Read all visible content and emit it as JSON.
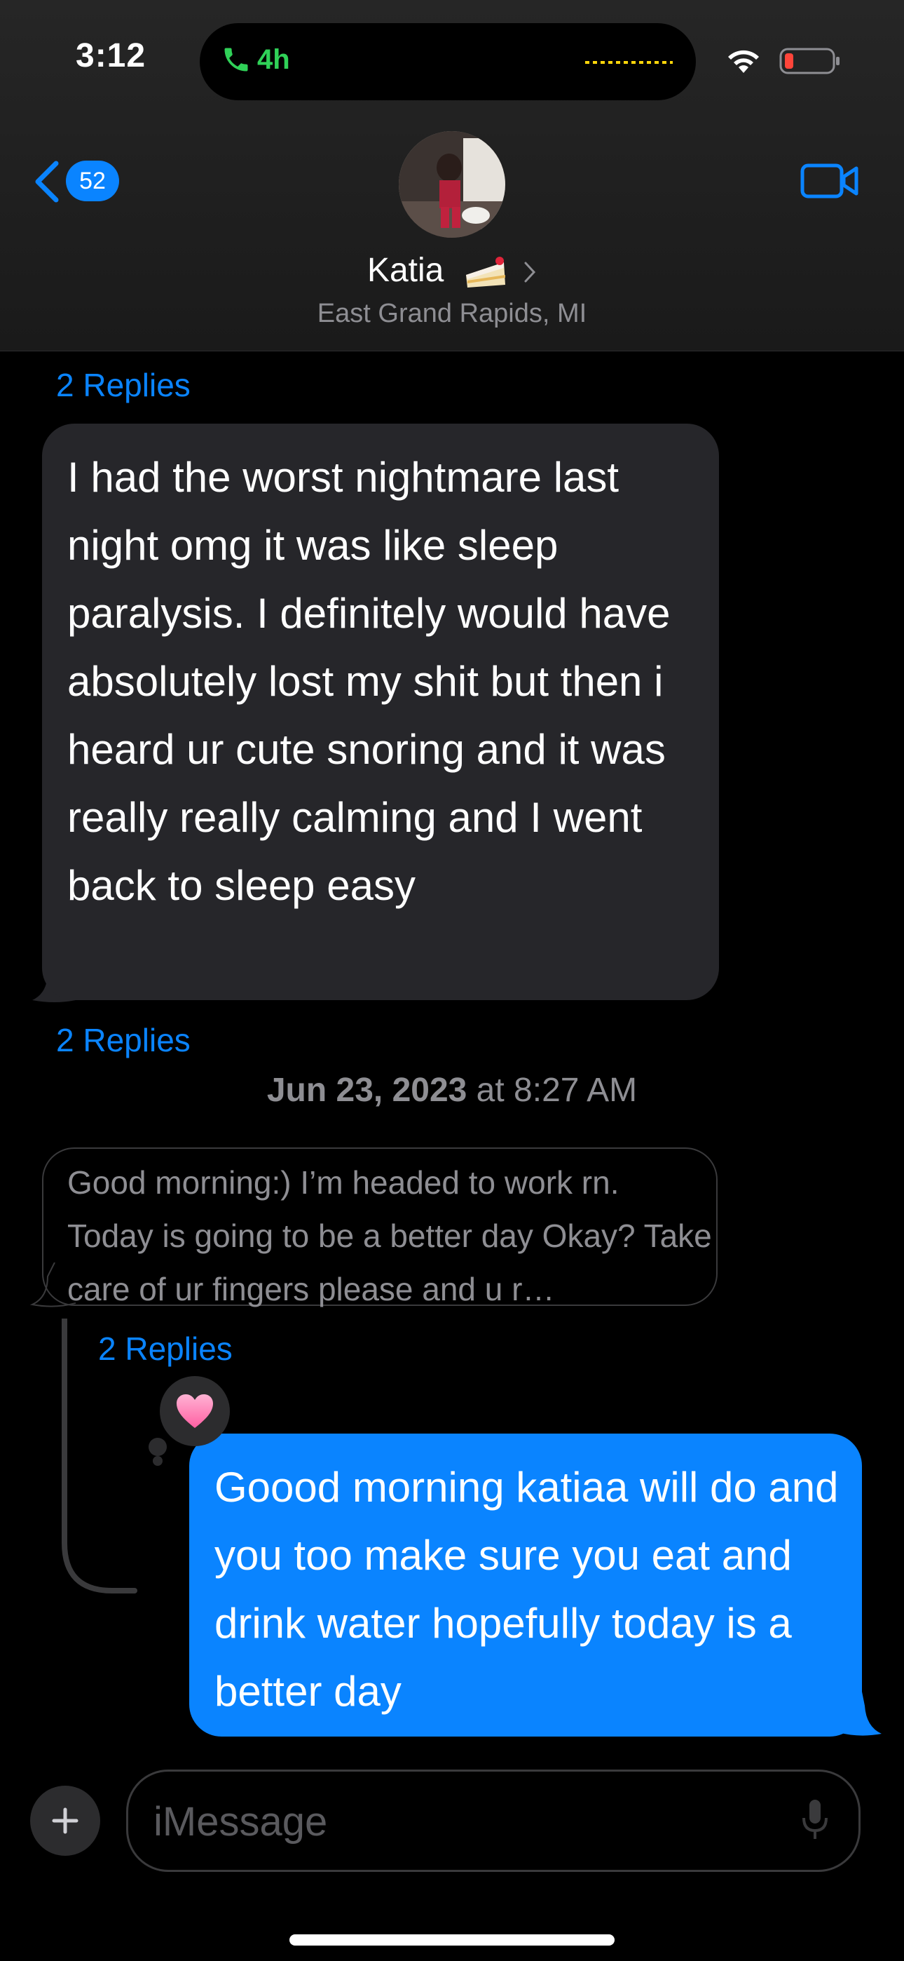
{
  "status_bar": {
    "time": "3:12",
    "call_duration": "4h",
    "call_color": "#30d158"
  },
  "header": {
    "back_badge": "52",
    "contact_name": "Katia",
    "contact_emoji": "cake-icon",
    "location": "East Grand Rapids, MI",
    "accent": "#0a84ff"
  },
  "messages": [
    {
      "replies": "2 Replies",
      "text": "I had the worst nightmare last night omg it was like sleep paralysis. I definitely would have absolutely lost my shit but then i heard ur cute snoring and it was really really calming and I went back to sleep easy",
      "direction": "received"
    },
    {
      "replies": "2 Replies"
    }
  ],
  "timestamp": {
    "date": "Jun 23, 2023",
    "time": " at 8:27 AM"
  },
  "thread": {
    "parent_text": "Good morning:) I’m headed to work rn. Today is going to be a better day Okay? Take care of ur fingers please and u r…",
    "replies": "2 Replies",
    "reaction": "heart-icon",
    "reply_text": "Goood morning katiaa will do and you too make sure you eat and drink water  hopefully today is a better day",
    "reply_color": "#0a84ff"
  },
  "input": {
    "placeholder": "iMessage"
  }
}
